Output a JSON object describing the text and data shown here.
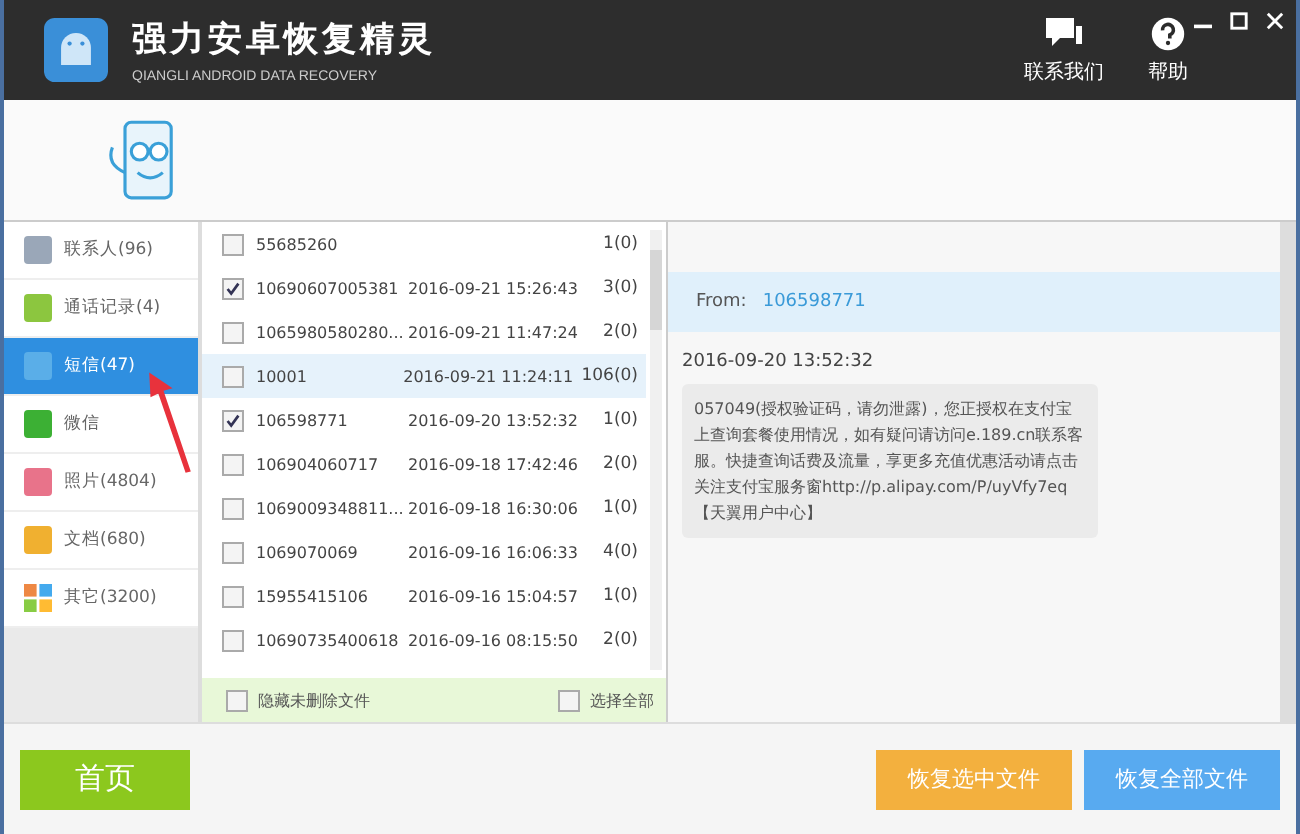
{
  "window": {
    "title": "强力安卓恢复精灵",
    "subtitle": "QIANGLI ANDROID DATA RECOVERY"
  },
  "header_actions": [
    {
      "kind": "contact",
      "label": "联系我们"
    },
    {
      "kind": "help",
      "label": "帮助"
    }
  ],
  "sidebar": {
    "items": [
      {
        "kind": "contacts",
        "label": "联系人(96)",
        "selected": false
      },
      {
        "kind": "calls",
        "label": "通话记录(4)",
        "selected": false
      },
      {
        "kind": "sms",
        "label": "短信(47)",
        "selected": true
      },
      {
        "kind": "wechat",
        "label": "微信",
        "selected": false
      },
      {
        "kind": "photos",
        "label": "照片(4804)",
        "selected": false
      },
      {
        "kind": "docs",
        "label": "文档(680)",
        "selected": false
      },
      {
        "kind": "other",
        "label": "其它(3200)",
        "selected": false
      }
    ]
  },
  "messages": {
    "rows": [
      {
        "sender": "55685260",
        "time": "",
        "count": "1(0)",
        "checked": false,
        "selected": false
      },
      {
        "sender": "10690607005381",
        "time": "2016-09-21 15:26:43",
        "count": "3(0)",
        "checked": true,
        "selected": false
      },
      {
        "sender": "1065980580280...",
        "time": "2016-09-21 11:47:24",
        "count": "2(0)",
        "checked": false,
        "selected": false
      },
      {
        "sender": "10001",
        "time": "2016-09-21 11:24:11",
        "count": "106(0)",
        "checked": false,
        "selected": true
      },
      {
        "sender": "106598771",
        "time": "2016-09-20 13:52:32",
        "count": "1(0)",
        "checked": true,
        "selected": false
      },
      {
        "sender": "106904060717",
        "time": "2016-09-18 17:42:46",
        "count": "2(0)",
        "checked": false,
        "selected": false
      },
      {
        "sender": "1069009348811...",
        "time": "2016-09-18 16:30:06",
        "count": "1(0)",
        "checked": false,
        "selected": false
      },
      {
        "sender": "1069070069",
        "time": "2016-09-16 16:06:33",
        "count": "4(0)",
        "checked": false,
        "selected": false
      },
      {
        "sender": "15955415106",
        "time": "2016-09-16 15:04:57",
        "count": "1(0)",
        "checked": false,
        "selected": false
      },
      {
        "sender": "10690735400618",
        "time": "2016-09-16 08:15:50",
        "count": "2(0)",
        "checked": false,
        "selected": false
      }
    ],
    "hide_undeleted": {
      "label": "隐藏未删除文件",
      "checked": false
    },
    "select_all": {
      "label": "选择全部",
      "checked": false
    }
  },
  "detail": {
    "from_label": "From:",
    "from": "106598771",
    "time": "2016-09-20 13:52:32",
    "body": "057049(授权验证码，请勿泄露)，您正授权在支付宝上查询套餐使用情况，如有疑问请访问e.189.cn联系客服。快捷查询话费及流量，享更多充值优惠活动请点击关注支付宝服务窗http://p.alipay.com/P/uyVfy7eq 【天翼用户中心】"
  },
  "buttons": [
    {
      "kind": "home",
      "label": "首页"
    },
    {
      "kind": "recover_selected",
      "label": "恢复选中文件"
    },
    {
      "kind": "recover_all",
      "label": "恢复全部文件"
    }
  ]
}
